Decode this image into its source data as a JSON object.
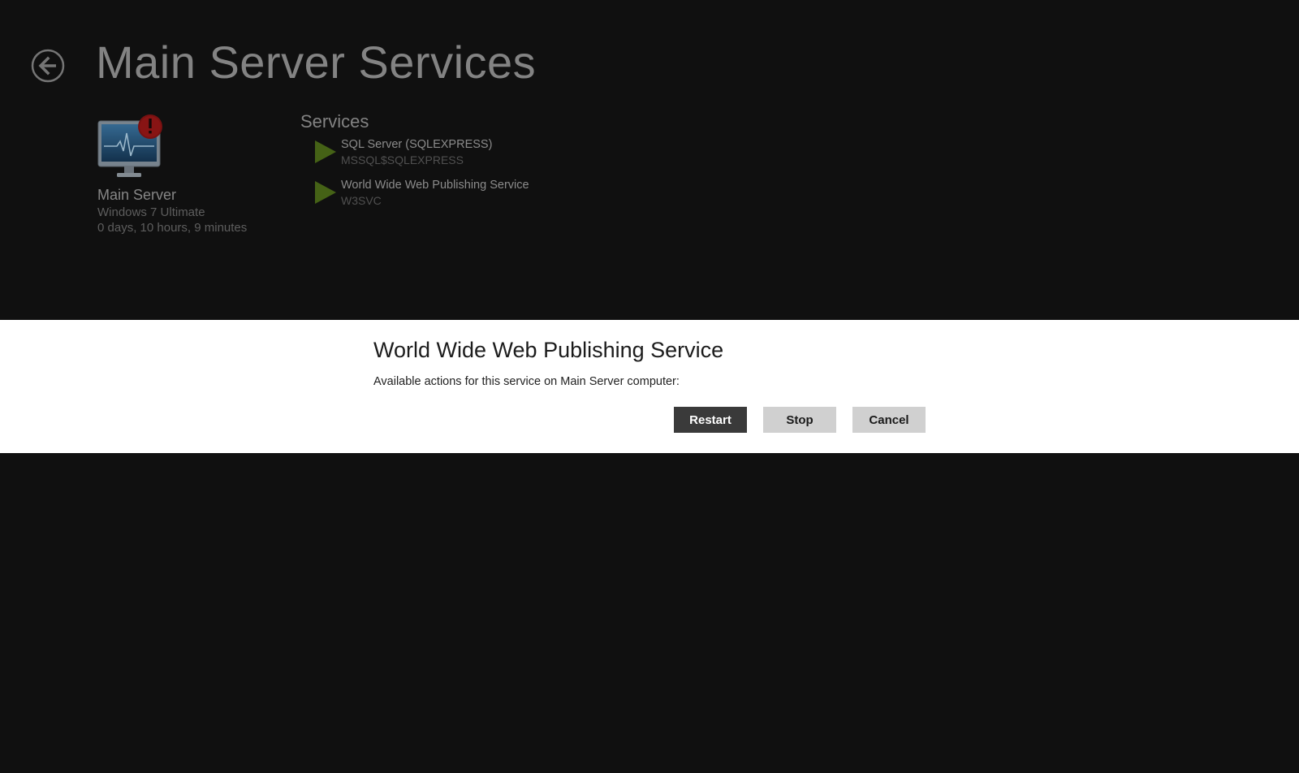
{
  "page": {
    "title": "Main Server Services"
  },
  "server": {
    "name": "Main Server",
    "os": "Windows 7 Ultimate",
    "uptime": "0 days, 10 hours, 9 minutes",
    "alert_badge": "!"
  },
  "services": {
    "heading": "Services",
    "items": [
      {
        "name": "SQL Server (SQLEXPRESS)",
        "id": "MSSQL$SQLEXPRESS",
        "status_icon": "play-icon"
      },
      {
        "name": "World Wide Web Publishing Service",
        "id": "W3SVC",
        "status_icon": "play-icon"
      }
    ]
  },
  "dialog": {
    "title": "World Wide Web Publishing Service",
    "message": "Available actions for this service on Main Server computer:",
    "buttons": {
      "restart": "Restart",
      "stop": "Stop",
      "cancel": "Cancel"
    }
  },
  "colors": {
    "background": "#131313",
    "play_icon": "#5a7a1e",
    "alert_badge": "#a01818",
    "primary_button": "#3a3a3a",
    "secondary_button": "#d0d0d0"
  }
}
